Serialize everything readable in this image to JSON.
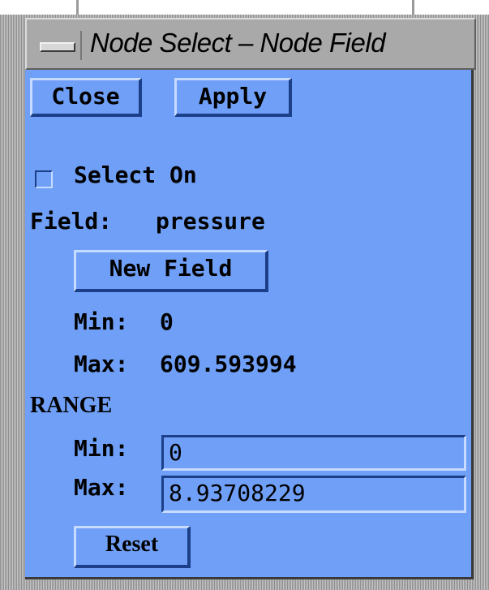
{
  "window": {
    "title": "Node Select – Node Field"
  },
  "toolbar": {
    "close_label": "Close",
    "apply_label": "Apply"
  },
  "select": {
    "checkbox_label": "Select On",
    "checked": false
  },
  "field": {
    "label": "Field:",
    "value": "pressure",
    "new_field_label": "New Field",
    "min_label": "Min:",
    "min_value": "0",
    "max_label": "Max:",
    "max_value": "609.593994"
  },
  "range": {
    "heading": "RANGE",
    "min_label": "Min:",
    "min_value": "0",
    "max_label": "Max:",
    "max_value": "8.93708229",
    "reset_label": "Reset"
  },
  "colors": {
    "panel_bg": "#6f9ff6",
    "frame_gray": "#a9a9a9",
    "shadow": "#1c3f8a",
    "highlight": "#c6dbff"
  }
}
